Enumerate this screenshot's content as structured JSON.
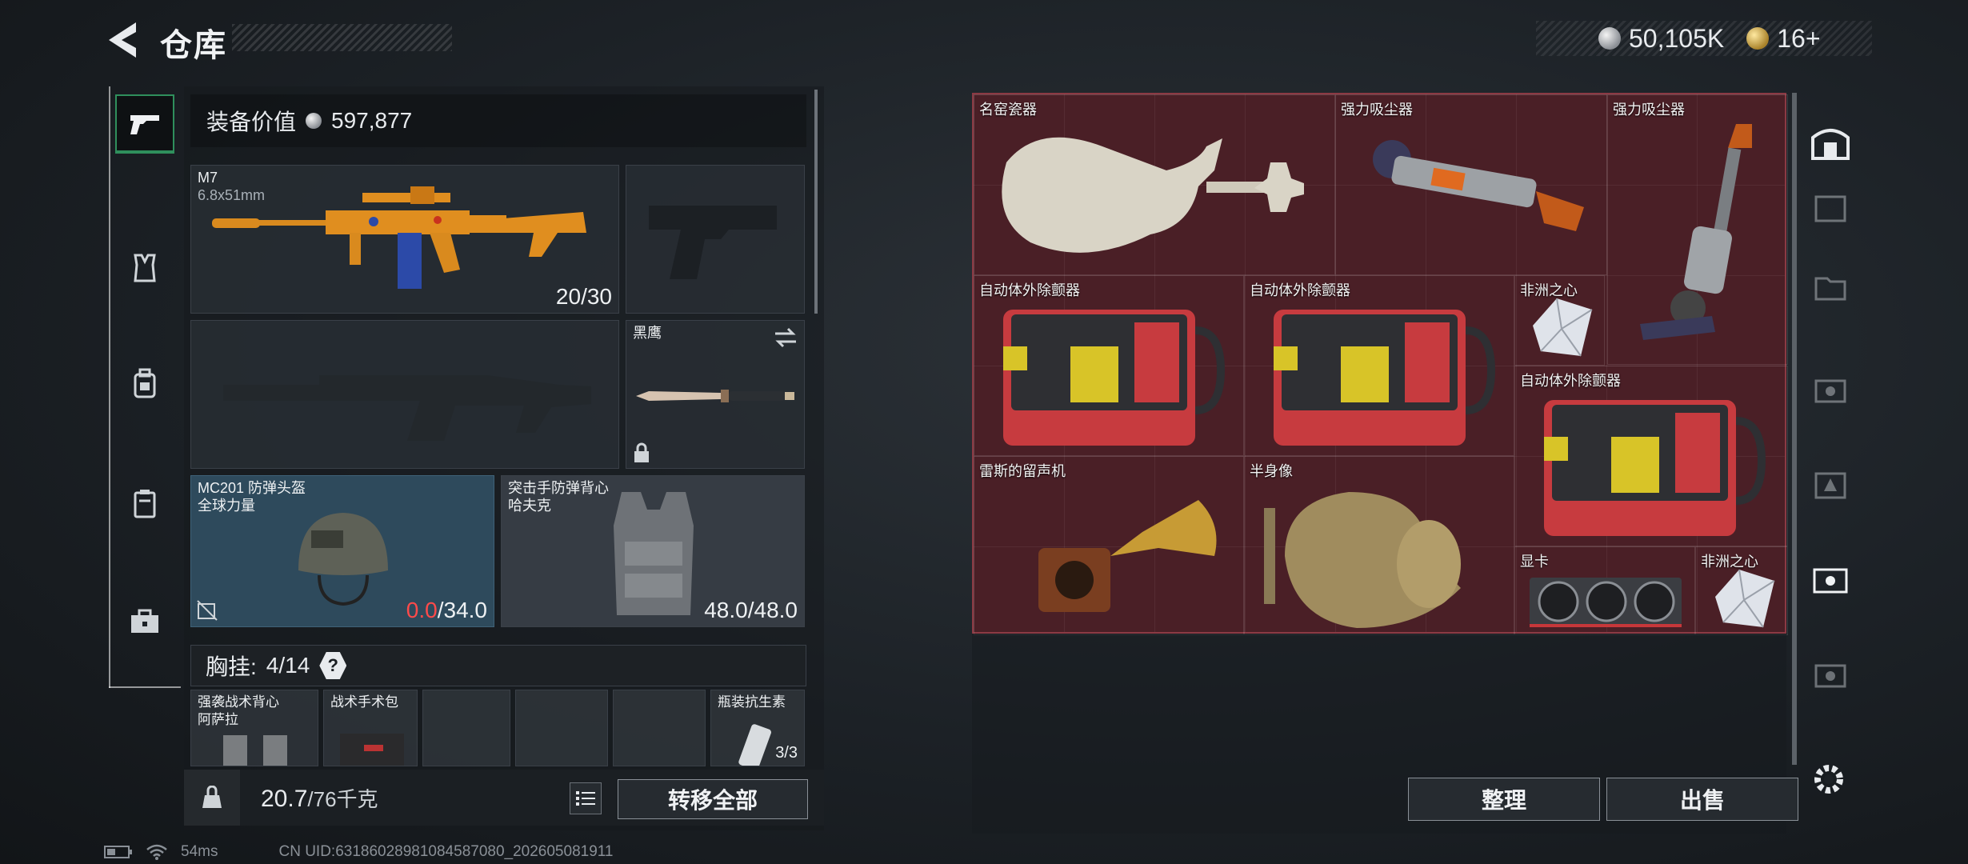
{
  "header": {
    "title": "仓库",
    "silver_amount": "50,105K",
    "gold_amount": "16+"
  },
  "left_nav": {
    "items": [
      "gun-icon",
      "shirt-icon",
      "backpack-icon",
      "case-icon",
      "toolbox-icon"
    ]
  },
  "loadout": {
    "equipment_value_label": "装备价值",
    "equipment_value": "597,877",
    "primary_weapon": {
      "name": "M7",
      "caliber": "6.8x51mm",
      "ammo": "20/30"
    },
    "knife": {
      "name": "黑鹰"
    },
    "helmet": {
      "name": "MC201 防弹头盔",
      "brand": "全球力量",
      "durability_current": "0.0",
      "durability_max": "/34.0"
    },
    "vest": {
      "name": "突击手防弹背心",
      "brand": "哈夫克",
      "durability": "48.0/48.0"
    },
    "chest_rig": {
      "label": "胸挂:",
      "count": "4/14",
      "help": "?"
    },
    "pouches": [
      {
        "name": "强袭战术背心",
        "brand": "阿萨拉"
      },
      {
        "name": "战术手术包"
      },
      {
        "name": ""
      },
      {
        "name": ""
      },
      {
        "name": ""
      },
      {
        "name": "瓶装抗生素",
        "count": "3/3"
      }
    ],
    "weight_current": "20.7",
    "weight_max": "/76千克",
    "transfer_all": "转移全部"
  },
  "storage": {
    "items": [
      {
        "name": "名窑瓷器"
      },
      {
        "name": "强力吸尘器"
      },
      {
        "name": "强力吸尘器"
      },
      {
        "name": "自动体外除颤器"
      },
      {
        "name": "自动体外除颤器"
      },
      {
        "name": "非洲之心"
      },
      {
        "name": "自动体外除颤器"
      },
      {
        "name": "雷斯的留声机"
      },
      {
        "name": "半身像"
      },
      {
        "name": "显卡"
      },
      {
        "name": "非洲之心"
      }
    ],
    "sort_button": "整理",
    "sell_button": "出售"
  },
  "colors": {
    "accent_green": "#2f8f5c",
    "storage_bg": "#4a1f26",
    "durability_red": "#ff4a4a"
  },
  "status_bar": {
    "ping": "54ms",
    "uid": "CN UID:63186028981084587080_202605081911"
  }
}
